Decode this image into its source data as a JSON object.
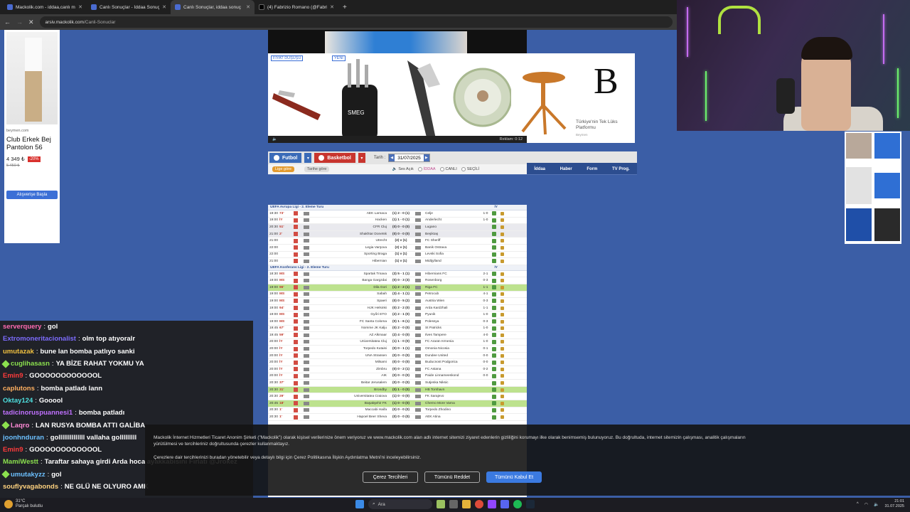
{
  "browser": {
    "tabs": [
      {
        "title": "Mackolik.com - iddaa,canlı maç",
        "active": false
      },
      {
        "title": "Canlı Sonuçlar - İddaa Sonuç",
        "active": false
      },
      {
        "title": "Canlı Sonuçlar, iddaa sonuç",
        "active": true
      },
      {
        "title": "(4) Fabrizio Romano (@Fabrizio",
        "active": false
      }
    ],
    "new_tab": "+",
    "url_domain": "arsiv.mackolik.com",
    "url_path": "/Canli-Sonuclar"
  },
  "left_ad": {
    "brand": "beymen.com",
    "title": "Club Erkek Bej Pantolon 56",
    "price": "4 349 ₺",
    "discount": "-20%",
    "old_price": "5 450 ₺",
    "button": "Alışverişe Başla"
  },
  "top_ad": {
    "tag1": "FIYAT DÜŞÜŞÜ",
    "tag2": "YENİ",
    "logo_letter": "B",
    "tagline": "Türkiye'nin Tek Lüks Platformu",
    "small": "Beymen",
    "video_time": "Reklam: 0:12"
  },
  "sport_bar": {
    "football": "Futbol",
    "basketball": "Basketbol",
    "date_label": "Tarih :",
    "date": "31/07/2025"
  },
  "filter_bar": {
    "by_league": "Lige göre",
    "by_date": "Tarihe göre",
    "sound": "Ses Açık",
    "iddaa": "İDDAA",
    "canli": "CANLI",
    "secili": "SEÇİLİ"
  },
  "nav_tabs": [
    "İddaa",
    "Haber",
    "Form",
    "TV Prog."
  ],
  "leagues": [
    {
      "name": "UEFA Avrupa Ligi - 2. Eleme Turu",
      "iy": "İY",
      "rows": [
        {
          "time": "19:30",
          "status": "73'",
          "home": "AEK Larnaca",
          "score": "(1) 2 - 0 (1)",
          "away": "Celje",
          "iy": "1-0",
          "hl": ""
        },
        {
          "time": "19:00",
          "status": "İY",
          "home": "Hacken",
          "score": "(1) 1 - 0 (1)",
          "away": "Anderlecht",
          "iy": "1-0",
          "hl": ""
        },
        {
          "time": "20:30",
          "status": "51'",
          "home": "CFR Cluj",
          "score": "(0) 0 - 0 (0)",
          "away": "Lugano",
          "iy": "",
          "hl": "grey"
        },
        {
          "time": "21:00",
          "status": "2'",
          "home": "Shakhtar Donetsk",
          "score": "(0) 0 - 0 (0)",
          "away": "Beşiktaş",
          "iy": "",
          "hl": "grey"
        },
        {
          "time": "21:00",
          "status": "",
          "home": "Utrecht",
          "score": "(2) v (1)",
          "away": "FC Sheriff",
          "iy": "",
          "hl": ""
        },
        {
          "time": "22:00",
          "status": "",
          "home": "Legia Varşova",
          "score": "(2) v (1)",
          "away": "Banik Ostrava",
          "iy": "",
          "hl": ""
        },
        {
          "time": "22:00",
          "status": "",
          "home": "Sporting Braga",
          "score": "(1) v (1)",
          "away": "Levski Sofia",
          "iy": "",
          "hl": ""
        },
        {
          "time": "21:00",
          "status": "",
          "home": "Hibernian",
          "score": "(1) v (1)",
          "away": "Midtjylland",
          "iy": "",
          "hl": ""
        }
      ]
    },
    {
      "name": "UEFA Konferans Ligi - 2. Eleme Turu",
      "iy": "İY",
      "rows": [
        {
          "time": "18:30",
          "status": "MS",
          "home": "Spartak Trnava",
          "score": "(3) 5 - 1 (1)",
          "away": "Hibernians FC",
          "iy": "2-1",
          "hl": ""
        },
        {
          "time": "19:00",
          "status": "MS",
          "home": "Banga Gargzdai",
          "score": "(0) 0 - 3 (3)",
          "away": "Rosenborg",
          "iy": "0-3",
          "hl": ""
        },
        {
          "time": "19:00",
          "status": "96'",
          "home": "Dila Gori",
          "score": "(1) 2 - 2 (1)",
          "away": "Riga FC",
          "iy": "1-1",
          "hl": "green"
        },
        {
          "time": "19:00",
          "status": "MS",
          "home": "Sabah",
          "score": "(3) 4 - 1 (1)",
          "away": "Petrocub",
          "iy": "4-1",
          "hl": ""
        },
        {
          "time": "19:00",
          "status": "MS",
          "home": "Spaeri",
          "score": "(0) 0 - 5 (2)",
          "away": "Austria Wien",
          "iy": "0-3",
          "hl": ""
        },
        {
          "time": "19:00",
          "status": "94'",
          "home": "HJK Helsinki",
          "score": "(0) 2 - 2 (0)",
          "away": "Arda Kardzhali",
          "iy": "1-1",
          "hl": ""
        },
        {
          "time": "19:00",
          "status": "MS",
          "home": "Győri ETO",
          "score": "(2) 2 - 1 (0)",
          "away": "Pyunik",
          "iy": "1-0",
          "hl": ""
        },
        {
          "time": "19:00",
          "status": "MS",
          "home": "FC Santa Coloma",
          "score": "(0) 1 - 6 (1)",
          "away": "Polessya",
          "iy": "0-3",
          "hl": ""
        },
        {
          "time": "19:45",
          "status": "67'",
          "home": "Nomme JK Kalju",
          "score": "(0) 2 - 0 (0)",
          "away": "St Patricks",
          "iy": "1-0",
          "hl": ""
        },
        {
          "time": "19:45",
          "status": "59'",
          "home": "AZ Alkmaar",
          "score": "(2) 4 - 0 (0)",
          "away": "Ilves Tampere",
          "iy": "4-0",
          "hl": ""
        },
        {
          "time": "20:00",
          "status": "İY",
          "home": "Universitatea Cluj",
          "score": "(1) 1 - 0 (0)",
          "away": "FC Ararat-Armenia",
          "iy": "1-0",
          "hl": ""
        },
        {
          "time": "20:00",
          "status": "İY",
          "home": "Torpedo Kutaisi",
          "score": "(0) 0 - 1 (1)",
          "away": "Omonia Nicosia",
          "iy": "0-1",
          "hl": ""
        },
        {
          "time": "20:00",
          "status": "İY",
          "home": "UNA Strassen",
          "score": "(0) 0 - 0 (0)",
          "away": "Dundee United",
          "iy": "0-0",
          "hl": ""
        },
        {
          "time": "20:00",
          "status": "İY",
          "home": "Milsami",
          "score": "(0) 0 - 0 (0)",
          "away": "Buducnost Podgorica",
          "iy": "0-0",
          "hl": ""
        },
        {
          "time": "20:00",
          "status": "İY",
          "home": "Zimbru",
          "score": "(0) 0 - 2 (1)",
          "away": "FC Astana",
          "iy": "0-2",
          "hl": ""
        },
        {
          "time": "20:00",
          "status": "İY",
          "home": "AIK",
          "score": "(0) 0 - 0 (0)",
          "away": "Paide Linnameeskond",
          "iy": "0-0",
          "hl": ""
        },
        {
          "time": "20:30",
          "status": "37'",
          "home": "Beitar Jerusalem",
          "score": "(0) 0 - 0 (0)",
          "away": "Sutjeska Niksic",
          "iy": "",
          "hl": ""
        },
        {
          "time": "20:30",
          "status": "31'",
          "home": "Brondby",
          "score": "(0) 1 - 0 (0)",
          "away": "HB Torshavn",
          "iy": "",
          "hl": "green"
        },
        {
          "time": "20:30",
          "status": "29'",
          "home": "Universitatea Craiova",
          "score": "(1) 0 - 0 (0)",
          "away": "FK Sarajevo",
          "iy": "",
          "hl": ""
        },
        {
          "time": "20:45",
          "status": "18'",
          "home": "Başakşehir FK",
          "score": "(1) 0 - 0 (0)",
          "away": "Cherno More Varna",
          "iy": "",
          "hl": "green"
        },
        {
          "time": "20:30",
          "status": "1'",
          "home": "Maccabi Haifa",
          "score": "(0) 0 - 0 (0)",
          "away": "Torpedo Zhodino",
          "iy": "",
          "hl": ""
        },
        {
          "time": "20:30",
          "status": "1'",
          "home": "Hapoel Beer Sheva",
          "score": "(0) 0 - 0 (0)",
          "away": "AEK Atina",
          "iy": "",
          "hl": ""
        }
      ]
    }
  ],
  "chat": [
    {
      "user": "serverquery",
      "color": "#ff6bb0",
      "text": "gol",
      "badge": false
    },
    {
      "user": "Extromoneritacionalist",
      "color": "#7d6cff",
      "text": "olm top atıyoralr",
      "badge": false
    },
    {
      "user": "umutazak",
      "color": "#f0c040",
      "text": "bune lan bomba patlıyo sanki",
      "badge": false
    },
    {
      "user": "cuglihasasn",
      "color": "#8be04e",
      "text": "YA BİZE RAHAT YOKMU YA",
      "badge": true
    },
    {
      "user": "Emin9",
      "color": "#ff3b3b",
      "text": "GOOOOOOOOOOOOL",
      "badge": false
    },
    {
      "user": "caplutons",
      "color": "#ffb060",
      "text": "bomba patladı lann",
      "badge": false
    },
    {
      "user": "Oktay124",
      "color": "#4ee0e0",
      "text": "Gooool",
      "badge": false
    },
    {
      "user": "tadicinoruspuannesi1",
      "color": "#c070ff",
      "text": "bomba patladı",
      "badge": false
    },
    {
      "user": "Laqro",
      "color": "#ff8ad6",
      "text": "LAN RUSYA BOMBA ATTI GALİBA",
      "badge": true
    },
    {
      "user": "joonhnduran",
      "color": "#6cc0ff",
      "text": "gollllllllllllll vallaha golllllllll",
      "badge": false
    },
    {
      "user": "Emin9",
      "color": "#ff3b3b",
      "text": "GOOOOOOOOOOOOL",
      "badge": false
    },
    {
      "user": "MamiWestt",
      "color": "#8be04e",
      "text": "Taraftar sahaya girdi Arda hoca ayakkabısını Fırlatı @Jrokez",
      "badge": false
    },
    {
      "user": "umutakyzz",
      "color": "#6cc0ff",
      "text": "gol",
      "badge": true
    },
    {
      "user": "souflyvagabonds",
      "color": "#ffd27f",
      "text": "NE GLÜ NE OLYURO AMK",
      "badge": false
    }
  ],
  "cookie": {
    "text1": "Mackolik İnternet Hizmetleri Ticaret Anonim Şirketi (\"Mackolik\") olarak kişisel verilerinize önem veriyoruz ve www.mackolik.com alan adlı internet sitemizi ziyaret edenlerin gizliliğini korumayı ilke olarak benimsemiş bulunuyoruz. Bu doğrultuda, internet sitemizin çalışması, analitik çalışmaların yürütülmesi ve tercihleriniz doğrultusunda çerezler kullanmaktayız.",
    "text2": "Çerezlere dair tercihlerinizi buradan yönetebilir veya detaylı bilgi için Çerez Politikasına İlişkin Aydınlatma Metni'ni inceleyebilirsiniz.",
    "btn_prefs": "Çerez Tercihleri",
    "btn_reject": "Tümünü Reddet",
    "btn_accept": "Tümünü Kabul Et"
  },
  "taskbar": {
    "temp": "31°C",
    "weather": "Parçalı bulutlu",
    "search": "Ara",
    "time": "21:01",
    "date": "31.07.2025"
  }
}
